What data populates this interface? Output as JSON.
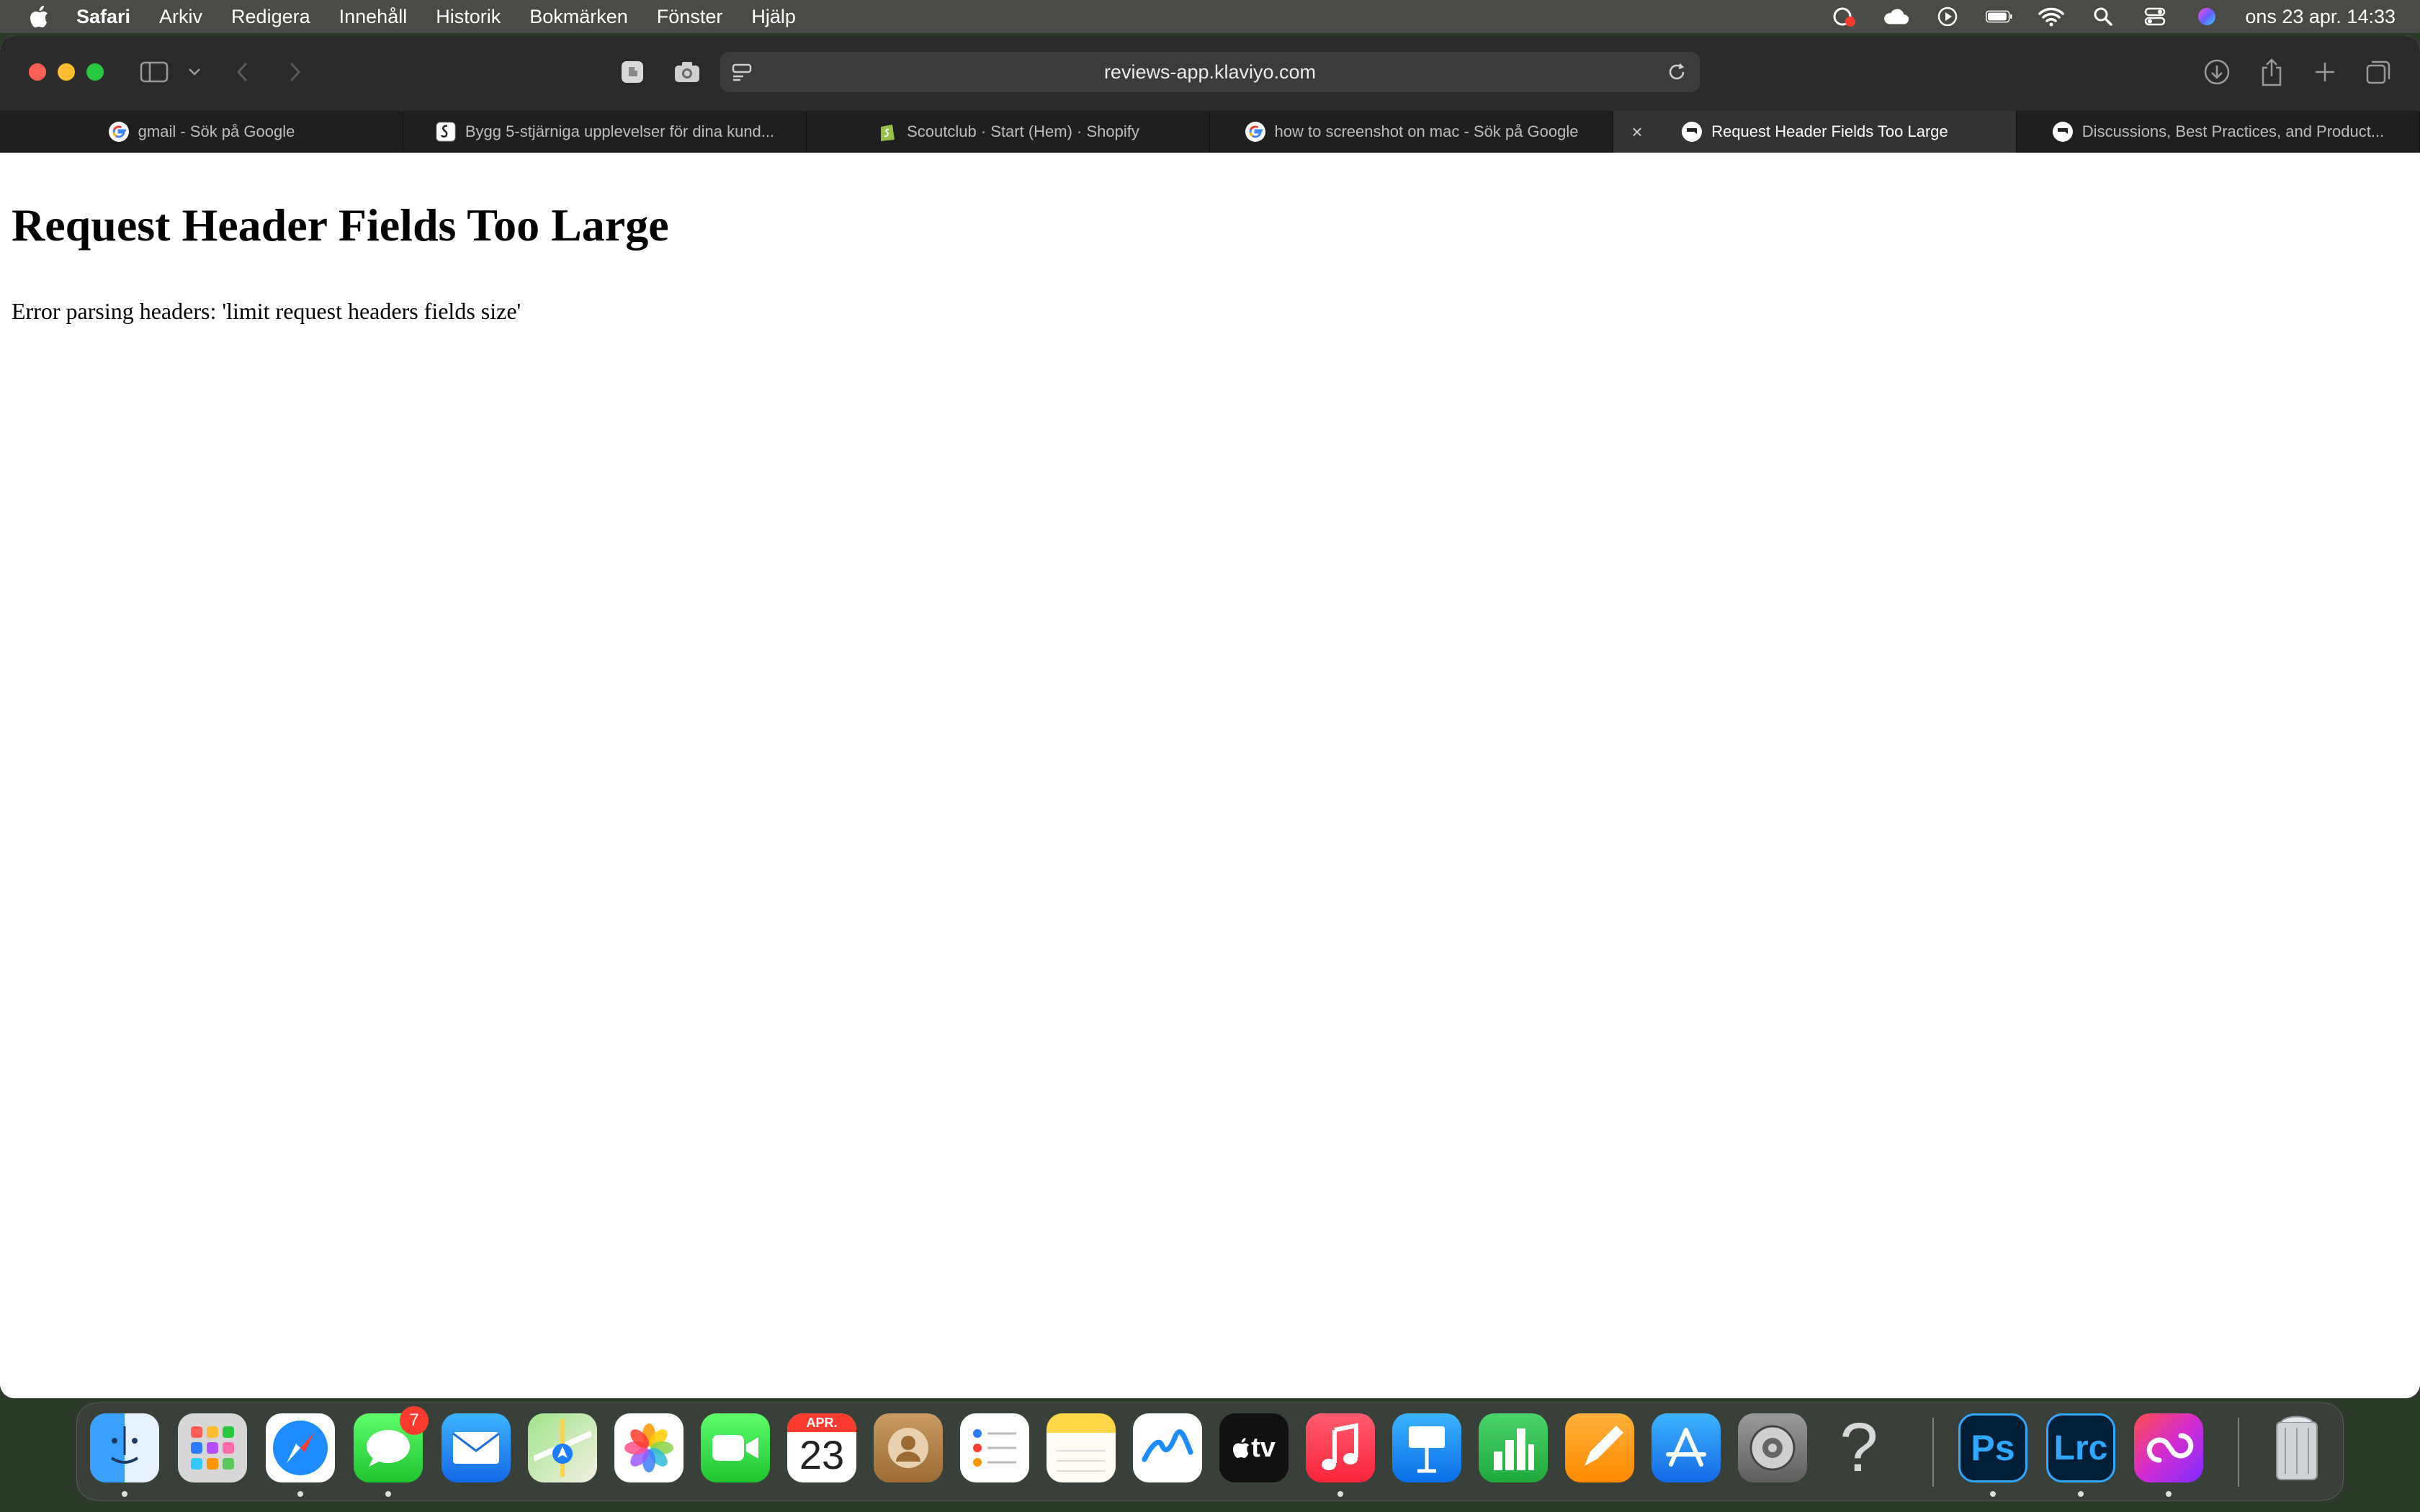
{
  "menubar": {
    "app_name": "Safari",
    "items": [
      "Arkiv",
      "Redigera",
      "Innehåll",
      "Historik",
      "Bokmärken",
      "Fönster",
      "Hjälp"
    ],
    "clock": "ons 23 apr. 14:33"
  },
  "toolbar": {
    "url": "reviews-app.klaviyo.com"
  },
  "tabs": [
    {
      "title": "gmail - Sök på Google",
      "favicon": "google-icon"
    },
    {
      "title": "Bygg 5-stjärniga upplevelser för dina kund...",
      "favicon": "shopify-app-icon"
    },
    {
      "title": "Scoutclub · Start (Hem) · Shopify",
      "favicon": "shopify-icon"
    },
    {
      "title": "how to screenshot on mac - Sök på Google",
      "favicon": "google-icon"
    },
    {
      "title": "Request Header Fields Too Large",
      "favicon": "klaviyo-icon",
      "active": true
    },
    {
      "title": "Discussions, Best Practices, and Product...",
      "favicon": "klaviyo-icon"
    }
  ],
  "page": {
    "heading": "Request Header Fields Too Large",
    "message": "Error parsing headers: 'limit request headers fields size'"
  },
  "dock": {
    "calendar_month": "APR.",
    "calendar_day": "23",
    "messages_badge": "7",
    "appletv_label": "tv",
    "photoshop_label": "Ps",
    "lightroom_label": "Lrc",
    "help_label": "?"
  }
}
